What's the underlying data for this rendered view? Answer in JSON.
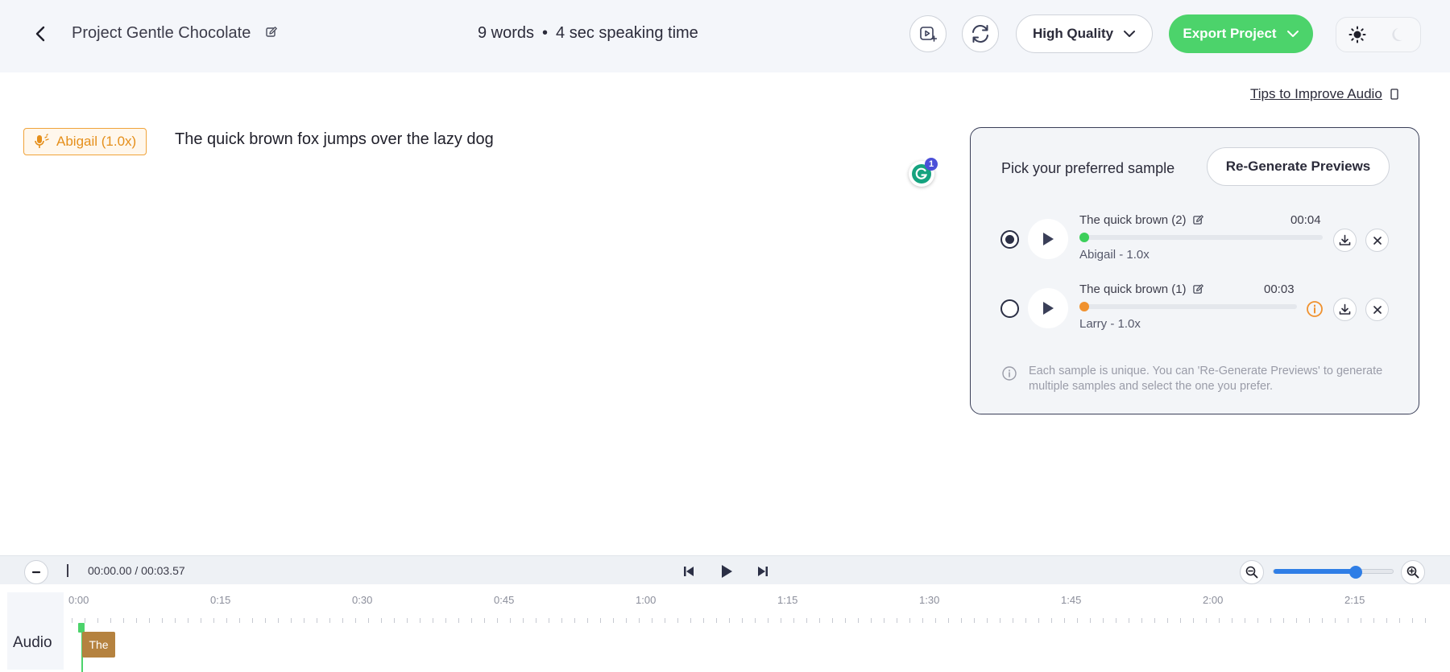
{
  "header": {
    "project_title": "Project Gentle Chocolate",
    "word_count": "9 words",
    "separator": "•",
    "speaking_time": "4 sec speaking time",
    "quality_label": "High Quality",
    "export_label": "Export Project"
  },
  "editor": {
    "tips_link": "Tips to Improve Audio",
    "voice_tag": "Abigail (1.0x)",
    "text": "The quick brown fox jumps over the lazy dog",
    "grammarly_count": "1"
  },
  "samples_panel": {
    "heading": "Pick your preferred sample",
    "regenerate_label": "Re-Generate Previews",
    "samples": [
      {
        "name": "The quick brown (2)",
        "duration": "00:04",
        "voice": "Abigail - 1.0x",
        "selected": true,
        "dot_color": "#3ccf5a"
      },
      {
        "name": "The quick brown (1)",
        "duration": "00:03",
        "voice": "Larry - 1.0x",
        "selected": false,
        "dot_color": "#f0922f"
      }
    ],
    "note": "Each sample is unique. You can 'Re-Generate Previews' to generate multiple samples and select the one you prefer."
  },
  "player": {
    "current_time": "00:00.00",
    "divider": "/",
    "total_time": "00:03.57",
    "zoom_level_fraction": 0.68
  },
  "timeline": {
    "track_label": "Audio",
    "ticks": [
      "0:00",
      "0:15",
      "0:30",
      "0:45",
      "1:00",
      "1:15",
      "1:30",
      "1:45",
      "2:00",
      "2:15"
    ],
    "clip_label": "The"
  },
  "colors": {
    "accent_green": "#4cd36b",
    "voice_orange": "#e58f1b",
    "clip_brown": "#b5823f",
    "zoom_blue": "#2f7ee6"
  }
}
